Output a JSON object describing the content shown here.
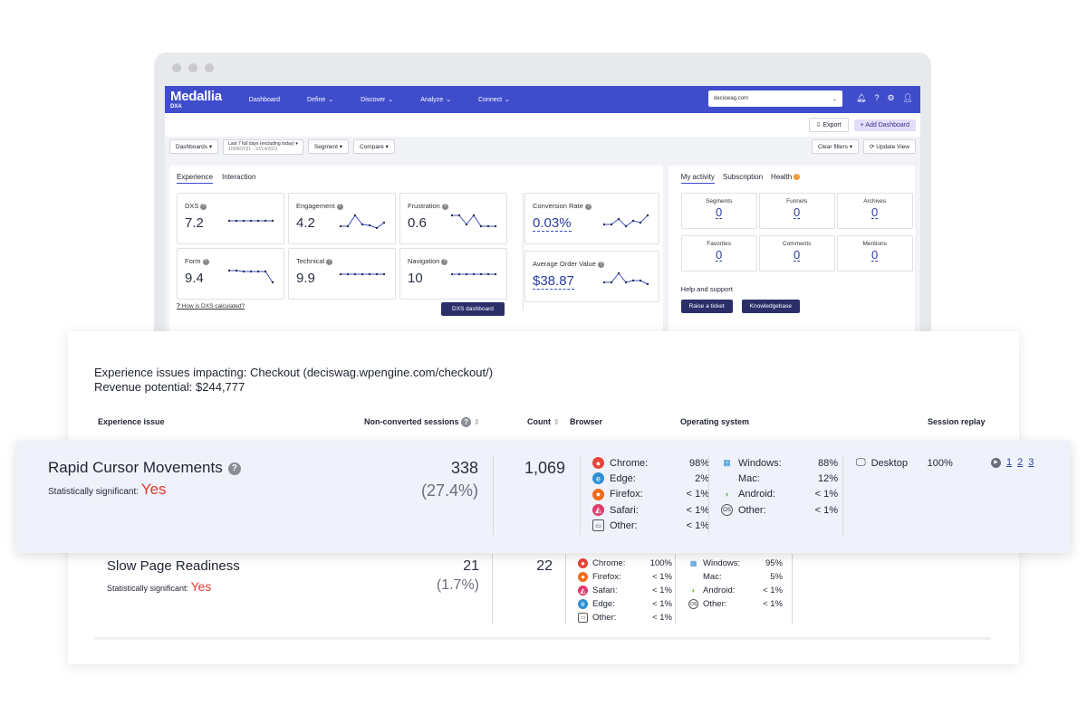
{
  "app": {
    "brand": "Medallia",
    "sub": "DXA",
    "nav": [
      "Dashboard",
      "Define",
      "Discover",
      "Analyze",
      "Connect"
    ],
    "account": "deciswag.com",
    "export_label": "Export",
    "add_dashboard_label": "Add Dashboard",
    "filters": {
      "dashboards": "Dashboards",
      "date_range": "Last 7 full days (excluding today)",
      "date_sub": "10/08/2021 - 10/14/2021",
      "segment": "Segment",
      "compare": "Compare",
      "clear_filters": "Clear filters",
      "update_view": "Update View"
    },
    "left_tabs": [
      "Experience",
      "Interaction"
    ],
    "metrics": [
      {
        "label": "DXS",
        "value": "7.2"
      },
      {
        "label": "Engagement",
        "value": "4.2"
      },
      {
        "label": "Frustration",
        "value": "0.6"
      },
      {
        "label": "Form",
        "value": "9.4"
      },
      {
        "label": "Technical",
        "value": "9.9"
      },
      {
        "label": "Navigation",
        "value": "10"
      }
    ],
    "conversion": {
      "label": "Conversion Rate",
      "value": "0.03%"
    },
    "aov": {
      "label": "Average Order Value",
      "value": "$38.87"
    },
    "how_link": "How is DXS calculated?",
    "dxs_button": "DXS dashboard",
    "right_tabs": [
      "My activity",
      "Subscription",
      "Health"
    ],
    "activity": [
      {
        "label": "Segments",
        "value": "0"
      },
      {
        "label": "Funnels",
        "value": "0"
      },
      {
        "label": "Archives",
        "value": "0"
      },
      {
        "label": "Favorites",
        "value": "0"
      },
      {
        "label": "Comments",
        "value": "0"
      },
      {
        "label": "Mentions",
        "value": "0"
      }
    ],
    "help_title": "Help and support",
    "raise_ticket": "Raise a ticket",
    "knowledgebase": "Knowledgebase"
  },
  "issues": {
    "title_line1": "Experience issues impacting: Checkout (deciswag.wpengine.com/checkout/)",
    "title_line2": "Revenue potential: $244,777",
    "headers": {
      "issue": "Experience issue",
      "nonconv": "Non-converted sessions",
      "count": "Count",
      "browser": "Browser",
      "os": "Operating system",
      "replay": "Session replay"
    },
    "rows": [
      {
        "name": "Rapid Cursor Movements",
        "sig_label": "Statistically significant:",
        "sig_value": "Yes",
        "sessions": "338",
        "sessions_pct": "(27.4%)",
        "count": "1,069",
        "browsers": [
          {
            "name": "Chrome:",
            "value": "98%",
            "icon": "chrome-icon"
          },
          {
            "name": "Edge:",
            "value": "2%",
            "icon": "edge-icon"
          },
          {
            "name": "Firefox:",
            "value": "< 1%",
            "icon": "firefox-icon"
          },
          {
            "name": "Safari:",
            "value": "< 1%",
            "icon": "safari-icon"
          },
          {
            "name": "Other:",
            "value": "< 1%",
            "icon": "browser-other-icon"
          }
        ],
        "os": [
          {
            "name": "Windows:",
            "value": "88%",
            "icon": "windows-icon"
          },
          {
            "name": "Mac:",
            "value": "12%",
            "icon": "apple-icon"
          },
          {
            "name": "Android:",
            "value": "< 1%",
            "icon": "android-icon"
          },
          {
            "name": "Other:",
            "value": "< 1%",
            "icon": "os-other-icon"
          }
        ],
        "device": "Desktop",
        "device_pct": "100%",
        "pages": [
          "1",
          "2",
          "3"
        ]
      },
      {
        "name": "Slow Page Readiness",
        "sig_label": "Statistically significant:",
        "sig_value": "Yes",
        "sessions": "21",
        "sessions_pct": "(1.7%)",
        "count": "22",
        "browsers": [
          {
            "name": "Chrome:",
            "value": "100%",
            "icon": "chrome-icon"
          },
          {
            "name": "Firefox:",
            "value": "< 1%",
            "icon": "firefox-icon"
          },
          {
            "name": "Safari:",
            "value": "< 1%",
            "icon": "safari-icon"
          },
          {
            "name": "Edge:",
            "value": "< 1%",
            "icon": "edge-icon"
          },
          {
            "name": "Other:",
            "value": "< 1%",
            "icon": "browser-other-icon"
          }
        ],
        "os": [
          {
            "name": "Windows:",
            "value": "95%",
            "icon": "windows-icon"
          },
          {
            "name": "Mac:",
            "value": "5%",
            "icon": "apple-icon"
          },
          {
            "name": "Android:",
            "value": "< 1%",
            "icon": "android-icon"
          },
          {
            "name": "Other:",
            "value": "< 1%",
            "icon": "os-other-icon"
          }
        ]
      }
    ]
  },
  "colors": {
    "brand": "#3f4dcd",
    "danger": "#e03b2e",
    "navy_button": "#2a2f6a"
  }
}
